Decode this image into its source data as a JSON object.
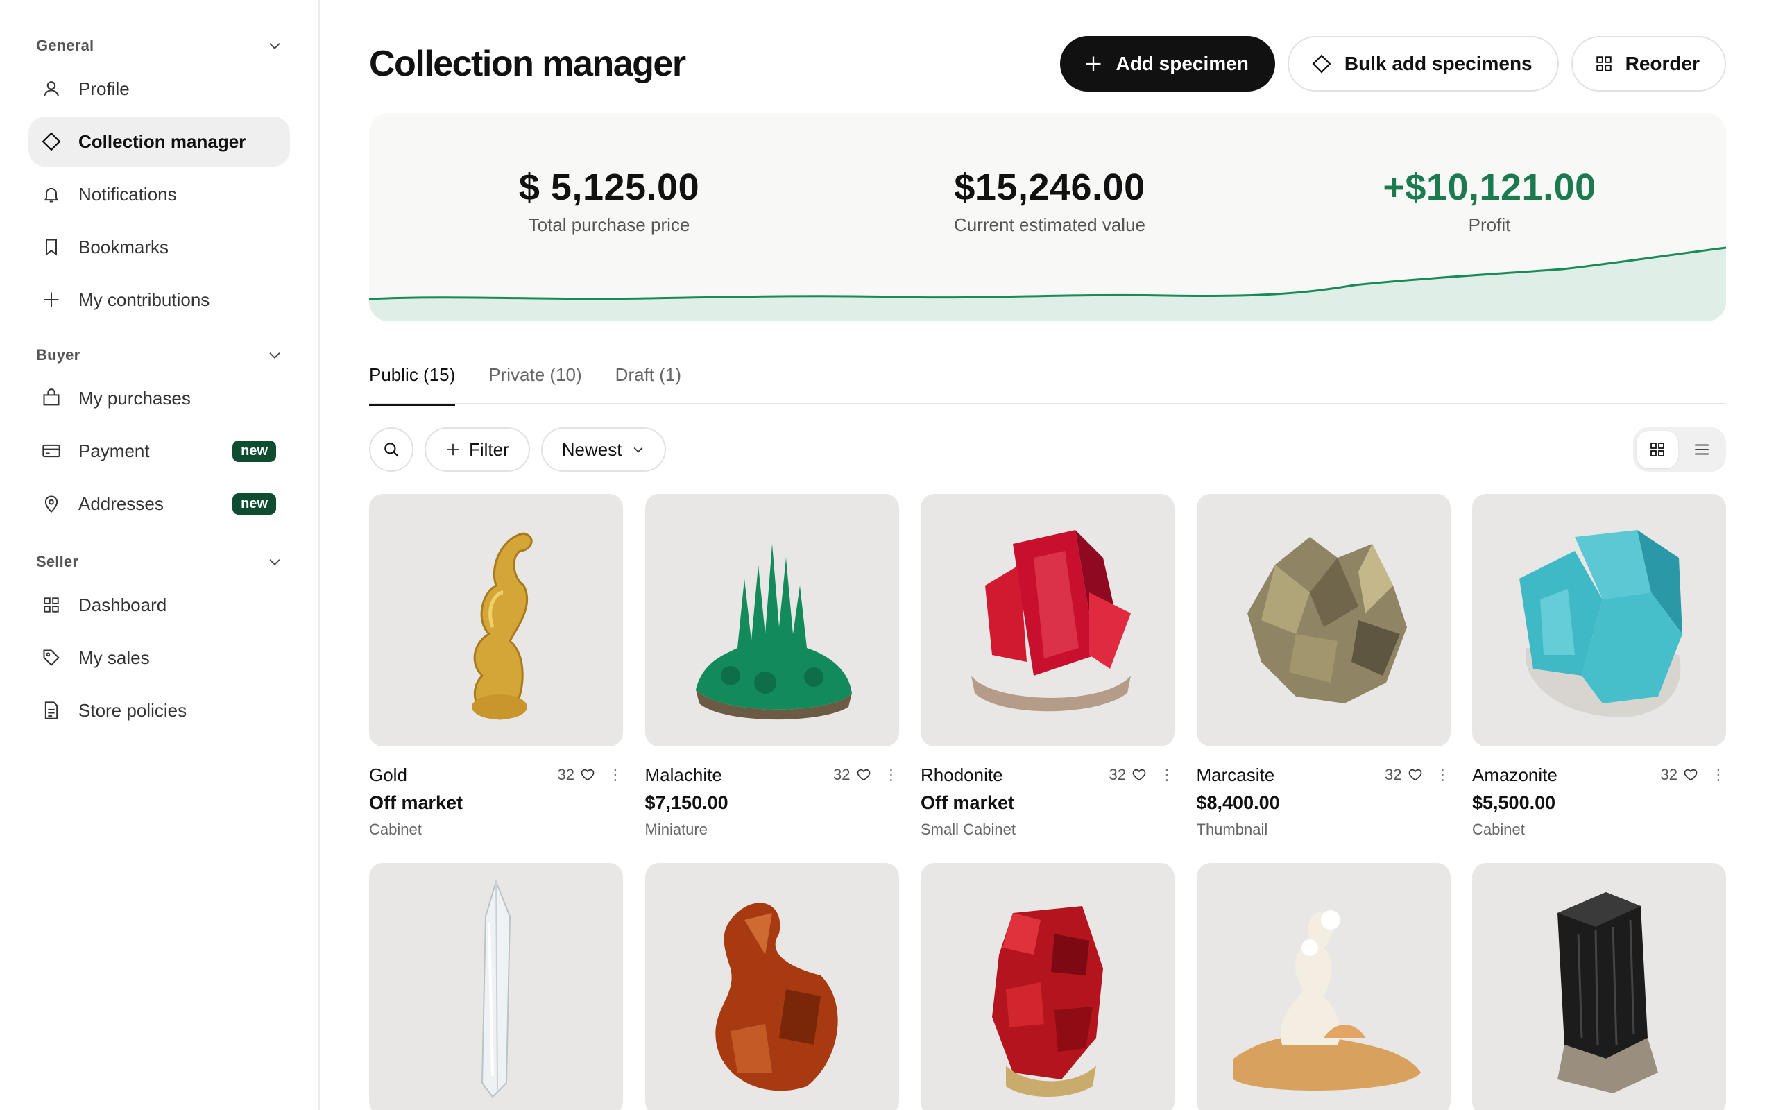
{
  "sidebar": {
    "sections": [
      {
        "title": "General",
        "items": [
          {
            "label": "Profile",
            "icon": "user-icon"
          },
          {
            "label": "Collection manager",
            "icon": "diamond-icon",
            "active": true
          },
          {
            "label": "Notifications",
            "icon": "bell-icon"
          },
          {
            "label": "Bookmarks",
            "icon": "bookmark-icon"
          },
          {
            "label": "My contributions",
            "icon": "plus-icon"
          }
        ]
      },
      {
        "title": "Buyer",
        "items": [
          {
            "label": "My purchases",
            "icon": "shopping-bag-icon"
          },
          {
            "label": "Payment",
            "icon": "credit-card-icon",
            "badge": "new"
          },
          {
            "label": "Addresses",
            "icon": "map-pin-icon",
            "badge": "new"
          }
        ]
      },
      {
        "title": "Seller",
        "items": [
          {
            "label": "Dashboard",
            "icon": "grid-icon"
          },
          {
            "label": "My sales",
            "icon": "tag-icon"
          },
          {
            "label": "Store policies",
            "icon": "document-icon"
          }
        ]
      }
    ]
  },
  "header": {
    "title": "Collection manager",
    "add_label": "Add specimen",
    "bulk_label": "Bulk add specimens",
    "reorder_label": "Reorder"
  },
  "stats": {
    "total_purchase_value": "$ 5,125.00",
    "total_purchase_label": "Total purchase price",
    "current_value": "$15,246.00",
    "current_label": "Current estimated value",
    "profit_value": "+$10,121.00",
    "profit_label": "Profit",
    "accent_color": "#1b7a4f"
  },
  "tabs": [
    {
      "label": "Public (15)",
      "active": true
    },
    {
      "label": "Private (10)"
    },
    {
      "label": "Draft (1)"
    }
  ],
  "toolbar": {
    "filter_label": "Filter",
    "sort_label": "Newest",
    "view_mode": "grid"
  },
  "specimens": [
    {
      "name": "Gold",
      "likes": "32",
      "price": "Off market",
      "size": "Cabinet",
      "color": "#d4a637"
    },
    {
      "name": "Malachite",
      "likes": "32",
      "price": "$7,150.00",
      "size": "Miniature",
      "color": "#128a5c"
    },
    {
      "name": "Rhodonite",
      "likes": "32",
      "price": "Off market",
      "size": "Small Cabinet",
      "color": "#c8102e"
    },
    {
      "name": "Marcasite",
      "likes": "32",
      "price": "$8,400.00",
      "size": "Thumbnail",
      "color": "#8f8463"
    },
    {
      "name": "Amazonite",
      "likes": "32",
      "price": "$5,500.00",
      "size": "Cabinet",
      "color": "#3fb9c6"
    },
    {
      "color": "#dfe6ea"
    },
    {
      "color": "#a83a12"
    },
    {
      "color": "#b3141d"
    },
    {
      "color": "#e3a564"
    },
    {
      "color": "#1c1c1c"
    }
  ]
}
